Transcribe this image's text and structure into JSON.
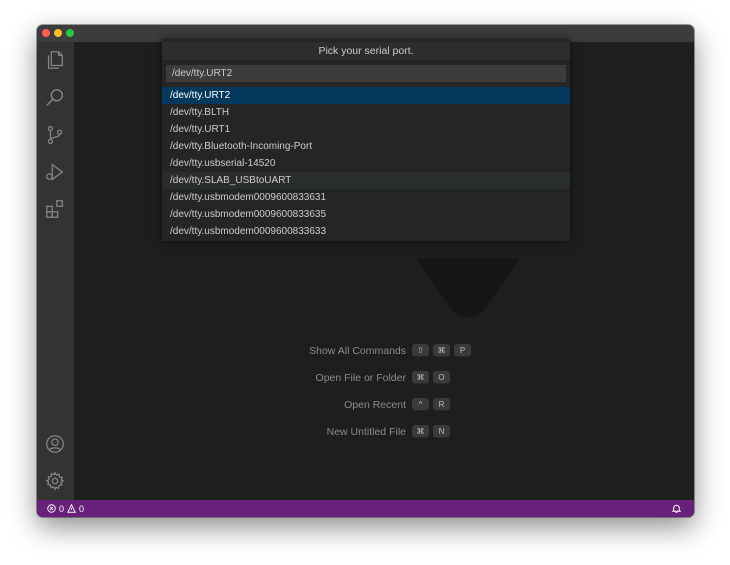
{
  "quick_pick": {
    "title": "Pick your serial port.",
    "input_value": "/dev/tty.URT2",
    "input_placeholder": "",
    "items": [
      "/dev/tty.URT2",
      "/dev/tty.BLTH",
      "/dev/tty.URT1",
      "/dev/tty.Bluetooth-Incoming-Port",
      "/dev/tty.usbserial-14520",
      "/dev/tty.SLAB_USBtoUART",
      "/dev/tty.usbmodem0009600833631",
      "/dev/tty.usbmodem0009600833635",
      "/dev/tty.usbmodem0009600833633"
    ],
    "selected_index": 0
  },
  "activity_bar": {
    "icons": [
      "explorer-icon",
      "search-icon",
      "source-control-icon",
      "run-debug-icon",
      "extensions-icon",
      "accounts-icon",
      "manage-gear-icon"
    ]
  },
  "shortcuts": [
    {
      "label": "Show All Commands",
      "keys": [
        "⇧",
        "⌘",
        "P"
      ]
    },
    {
      "label": "Open File or Folder",
      "keys": [
        "⌘",
        "O"
      ]
    },
    {
      "label": "Open Recent",
      "keys": [
        "^",
        "R"
      ]
    },
    {
      "label": "New Untitled File",
      "keys": [
        "⌘",
        "N"
      ]
    }
  ],
  "status_bar": {
    "errors": "0",
    "warnings": "0",
    "color": "#68217a"
  },
  "colors": {
    "selection": "#04395e",
    "editor_bg": "#1e1e1e",
    "activity_bar_bg": "#333333"
  }
}
